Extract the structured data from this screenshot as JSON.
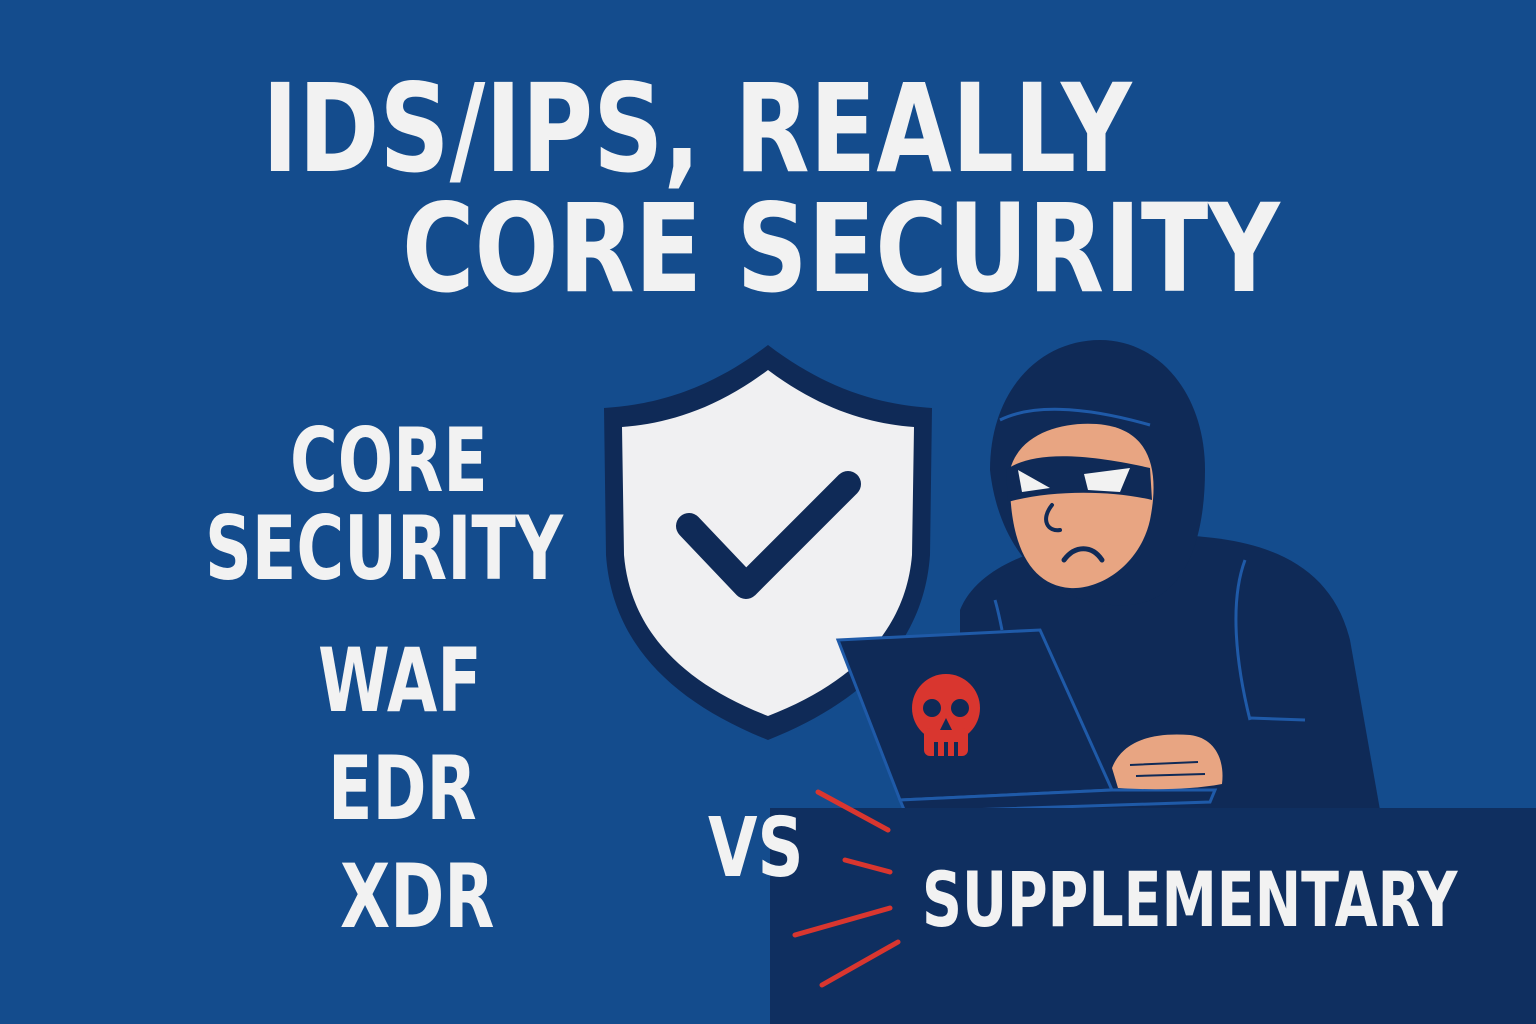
{
  "title": {
    "line1": "IDS/IPS, REALLY",
    "line2": "CORE SECURITY"
  },
  "core_list": {
    "heading_line1": "CORE",
    "heading_line2": "SECURITY",
    "items": [
      "WAF",
      "EDR",
      "XDR"
    ]
  },
  "versus": "VS",
  "supplementary": "SUPPLEMENTARY",
  "icons": {
    "shield": "shield-check-icon",
    "hacker": "hooded-hacker-icon",
    "laptop": "laptop-icon",
    "skull": "skull-icon",
    "burst": "impact-lines-icon"
  },
  "colors": {
    "background": "#144c8d",
    "panel": "#0f2f60",
    "text": "#f2f2f2",
    "shield_fill": "#f0f0f2",
    "shield_outline": "#0f2a57",
    "hood": "#0f2a57",
    "skin": "#e8a582",
    "accent_red": "#d9362f"
  }
}
